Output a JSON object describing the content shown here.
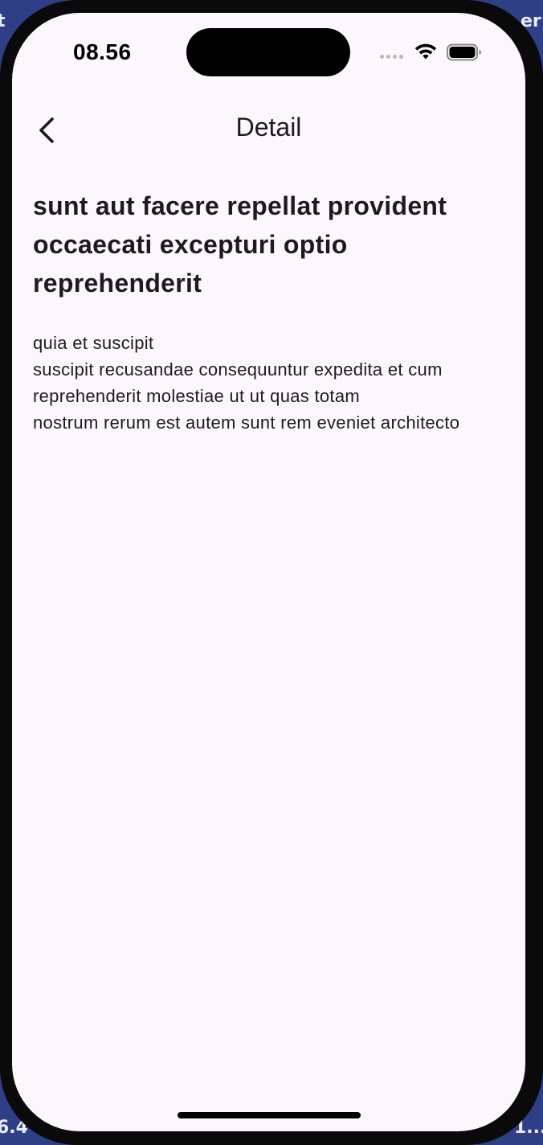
{
  "desktop": {
    "top_left_fragment": "t",
    "top_right_fragment": "er",
    "bottom_left_fragment": "6.4",
    "bottom_right_fragment": "1..."
  },
  "status_bar": {
    "time": "08.56",
    "wifi_icon": "wifi-icon",
    "battery_icon": "battery-icon"
  },
  "nav": {
    "back_icon": "chevron-left-icon",
    "title": "Detail"
  },
  "post": {
    "title": "sunt aut facere repellat provident occaecati excepturi optio reprehenderit",
    "body": "quia et suscipit\nsuscipit recusandae consequuntur expedita et cum reprehenderit molestiae ut ut quas totam\nnostrum rerum est autem sunt rem eveniet architecto"
  },
  "colors": {
    "screen_background": "#fcf7fc",
    "text": "#1d1b20",
    "desktop_background": "#2f3f86"
  }
}
